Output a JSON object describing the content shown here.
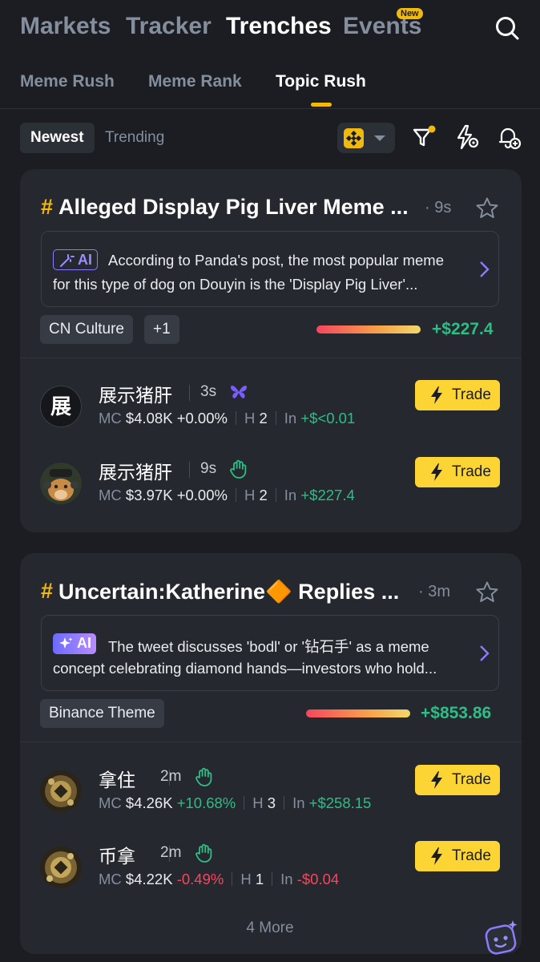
{
  "topnav": {
    "markets": "Markets",
    "tracker": "Tracker",
    "trenches": "Trenches",
    "events": "Events",
    "new_badge": "New"
  },
  "subtabs": {
    "meme_rush": "Meme Rush",
    "meme_rank": "Meme Rank",
    "topic_rush": "Topic Rush"
  },
  "filters": {
    "newest": "Newest",
    "trending": "Trending"
  },
  "colors": {
    "accent": "#f0b90b",
    "positive": "#2ebd85",
    "negative": "#f6465d",
    "background": "#1b1d22",
    "card": "#25282e"
  },
  "topics": [
    {
      "title": "Alleged Display Pig Liver Meme ...",
      "age": "· 9s",
      "ai_label": "AI",
      "ai_line1": "According to Panda's post, the most popular meme",
      "ai_line2": "for this type of dog on Douyin is the 'Display Pig Liver'...",
      "tags": [
        "CN Culture",
        "+1"
      ],
      "inflow": "+$227.4",
      "tokens": [
        {
          "name": "展示猪肝",
          "age": "3s",
          "badge": "butterfly-icon",
          "mc_label": "MC",
          "mc": "$4.08K",
          "change": "+0.00%",
          "h_label": "H",
          "holders": "2",
          "in_label": "In",
          "inflow": "+$<0.01",
          "trade": "Trade",
          "avatar_text": "展"
        },
        {
          "name": "展示猪肝",
          "age": "9s",
          "badge": "hand-wave-icon",
          "mc_label": "MC",
          "mc": "$3.97K",
          "change": "+0.00%",
          "h_label": "H",
          "holders": "2",
          "in_label": "In",
          "inflow": "+$227.4",
          "trade": "Trade"
        }
      ]
    },
    {
      "title": "Uncertain:Katherine🔶 Replies ...",
      "age": "· 3m",
      "ai_label": "AI",
      "ai_line1": "The tweet discusses 'bodl' or '钻石手' as a meme",
      "ai_line2": "concept celebrating diamond hands—investors who hold...",
      "tags": [
        "Binance Theme"
      ],
      "inflow": "+$853.86",
      "tokens": [
        {
          "name": "拿住",
          "age": "2m",
          "badge": "hand-wave-icon",
          "mc_label": "MC",
          "mc": "$4.26K",
          "change": "+10.68%",
          "h_label": "H",
          "holders": "3",
          "in_label": "In",
          "inflow": "+$258.15",
          "trade": "Trade"
        },
        {
          "name": "币拿",
          "age": "2m",
          "badge": "hand-wave-icon",
          "mc_label": "MC",
          "mc": "$4.22K",
          "change": "-0.49%",
          "h_label": "H",
          "holders": "1",
          "in_label": "In",
          "inflow": "-$0.04",
          "trade": "Trade"
        }
      ],
      "more": "4 More"
    }
  ]
}
